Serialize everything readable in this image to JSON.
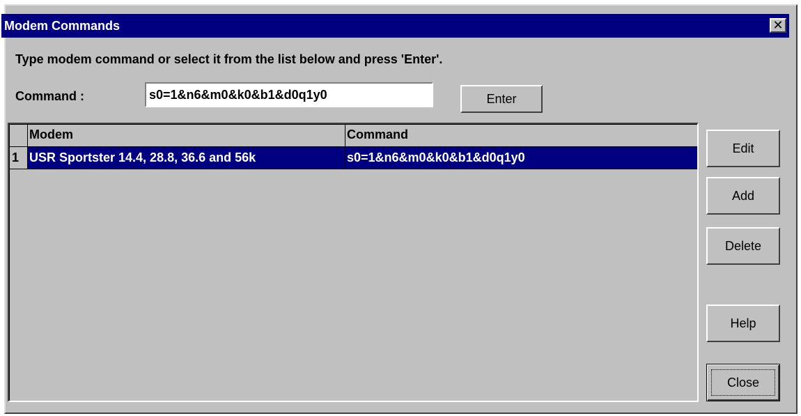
{
  "window": {
    "title": "Modem Commands",
    "close_glyph": "✕"
  },
  "instruction": "Type modem command or select it from the list below and press 'Enter'.",
  "command": {
    "label": "Command :",
    "value": "s0=1&n6&m0&k0&b1&d0q1y0"
  },
  "buttons": {
    "enter": "Enter",
    "edit": "Edit",
    "add": "Add",
    "delete": "Delete",
    "help": "Help",
    "close": "Close"
  },
  "table": {
    "columns": [
      "Modem",
      "Command"
    ],
    "rows": [
      {
        "num": "1",
        "modem": "USR Sportster 14.4, 28.8, 36.6 and 56k",
        "command": "s0=1&n6&m0&k0&b1&d0q1y0",
        "selected": true
      }
    ]
  },
  "colors": {
    "titlebar": "#000080",
    "selection": "#000080",
    "face": "#c0c0c0"
  }
}
